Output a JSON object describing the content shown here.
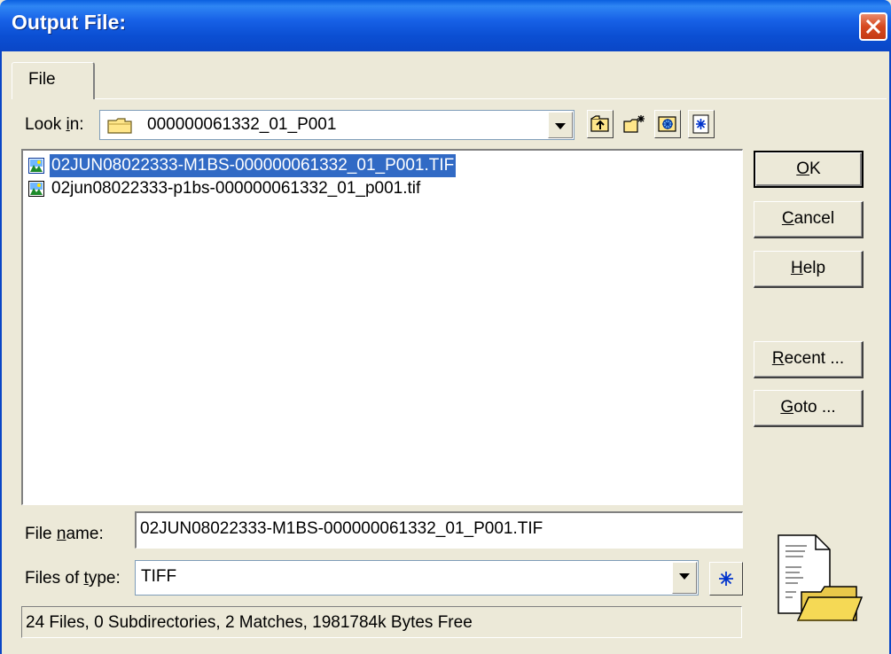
{
  "window": {
    "title": "Output File:"
  },
  "tabs": [
    {
      "label": "File"
    }
  ],
  "look_in": {
    "label_pre": "Look ",
    "label_mnemonic": "i",
    "label_post": "n:",
    "value": "000000061332_01_P001",
    "icon": "folder-icon"
  },
  "toolbar": [
    {
      "name": "up-one-level",
      "icon": "folder-up-icon"
    },
    {
      "name": "create-new-folder",
      "icon": "new-folder-icon"
    },
    {
      "name": "list-view",
      "icon": "list-view-icon"
    },
    {
      "name": "details",
      "icon": "asterisk-icon"
    }
  ],
  "files": [
    {
      "name": "02JUN08022333-M1BS-000000061332_01_P001.TIF",
      "icon": "image-file-icon",
      "selected": true
    },
    {
      "name": "02jun08022333-p1bs-000000061332_01_p001.tif",
      "icon": "image-file-icon",
      "selected": false
    }
  ],
  "buttons": {
    "ok": {
      "mnemonic": "O",
      "rest": "K"
    },
    "cancel": {
      "mnemonic": "C",
      "rest": "ancel"
    },
    "help": {
      "mnemonic": "H",
      "rest": "elp"
    },
    "recent": {
      "mnemonic": "R",
      "rest": "ecent ..."
    },
    "goto": {
      "mnemonic": "G",
      "rest": "oto ..."
    }
  },
  "file_name": {
    "label_pre": "File ",
    "label_mnemonic": "n",
    "label_post": "ame:",
    "value": "02JUN08022333-M1BS-000000061332_01_P001.TIF"
  },
  "file_type": {
    "label_pre": "Files of ",
    "label_mnemonic": "t",
    "label_post": "ype:",
    "value": "TIFF",
    "filter_icon": "asterisk-icon"
  },
  "status": "24 Files, 0 Subdirectories, 2 Matches, 1981784k Bytes Free",
  "colors": {
    "title_bar": "#0a46c6",
    "selection": "#316ac5",
    "dialog_bg": "#ece9d8"
  }
}
